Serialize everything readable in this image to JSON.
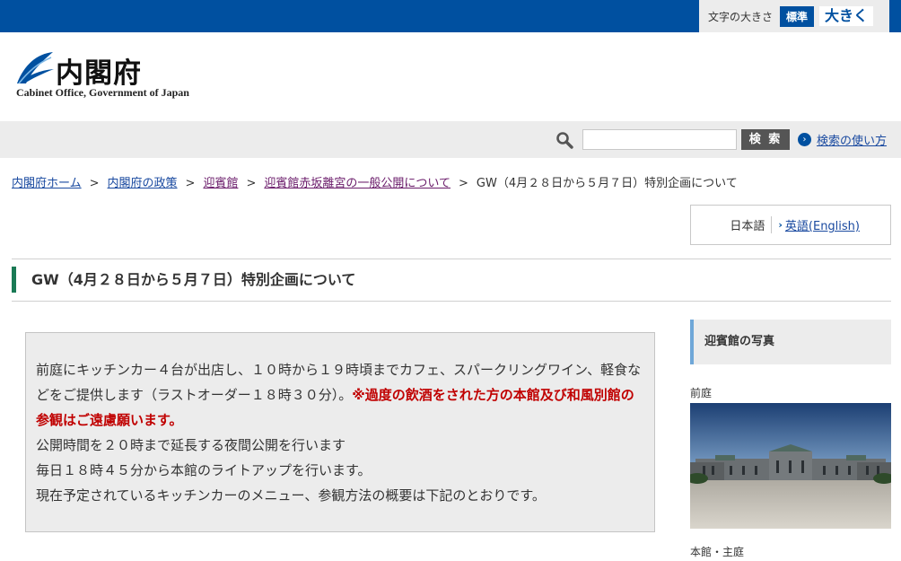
{
  "topbar": {
    "font_size_label": "文字の大きさ",
    "standard_label": "標準",
    "large_label": "大きく",
    "brand_color": "#0050a0"
  },
  "logo": {
    "name": "内閣府",
    "subtitle": "Cabinet Office, Government of Japan",
    "icon": "cabinet-office-emblem"
  },
  "search": {
    "icon": "search-icon",
    "value": "",
    "button_label": "検 索",
    "howto_label": "検索の使い方"
  },
  "breadcrumb": {
    "items": [
      "内閣府ホーム",
      "内閣府の政策",
      "迎賓館",
      "迎賓館赤坂離宮の一般公開について"
    ],
    "separator": ">",
    "current": "GW（4月２８日から５月７日）特別企画について"
  },
  "language": {
    "japanese": "日本語",
    "english": "英語(English)"
  },
  "page": {
    "title": "GW（4月２８日から５月７日）特別企画について",
    "accent_color": "#1a7a55"
  },
  "notice": {
    "para1_text": "前庭にキッチンカー４台が出店し、１０時から１９時頃までカフェ、スパークリングワイン、軽食などをご提供します（ラストオーダー１８時３０分）。",
    "para1_warning": "※過度の飲酒をされた方の本館及び和風別館の参観はご遠慮願います。",
    "line2": "公開時間を２０時まで延長する夜間公開を行います",
    "line3": "毎日１８時４５分から本館のライトアップを行います。",
    "line4": "現在予定されているキッチンカーのメニュー、参観方法の概要は下記のとおりです。",
    "warning_color": "#c00000"
  },
  "sidebar": {
    "heading": "迎賓館の写真",
    "caption1": "前庭",
    "caption2": "本館・主庭"
  }
}
